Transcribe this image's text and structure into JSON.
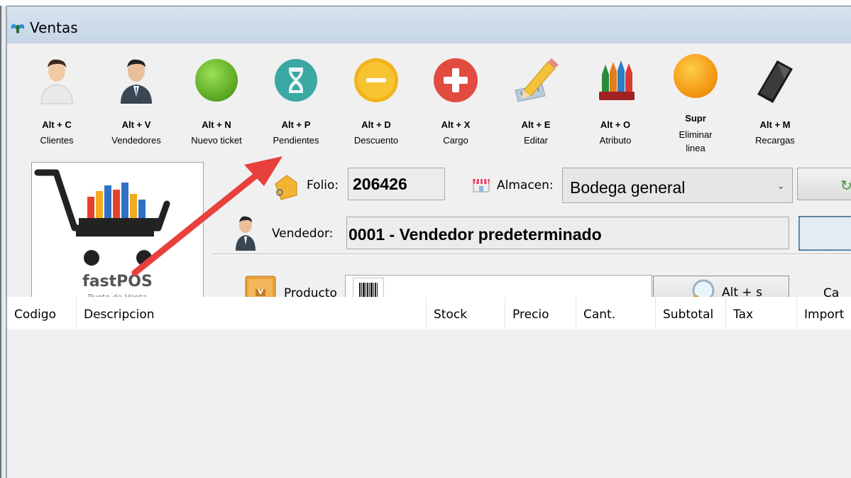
{
  "window": {
    "title": "Ventas"
  },
  "toolbar": {
    "buttons": [
      {
        "key": "Alt + C",
        "label": "Clientes",
        "icon": "client-person-icon"
      },
      {
        "key": "Alt + V",
        "label": "Vendedores",
        "icon": "seller-person-icon"
      },
      {
        "key": "Alt + N",
        "label": "Nuevo ticket",
        "icon": "green-circle-icon"
      },
      {
        "key": "Alt + P",
        "label": "Pendientes",
        "icon": "hourglass-icon"
      },
      {
        "key": "Alt + D",
        "label": "Descuento",
        "icon": "minus-circle-icon"
      },
      {
        "key": "Alt + X",
        "label": "Cargo",
        "icon": "plus-circle-icon"
      },
      {
        "key": "Alt + E",
        "label": "Editar",
        "icon": "pencil-ruler-icon"
      },
      {
        "key": "Alt + O",
        "label": "Atributo",
        "icon": "crayons-icon"
      },
      {
        "key": "Supr",
        "label": "Eliminar\nlinea",
        "icon": "orange-circle-icon"
      },
      {
        "key": "Alt + M",
        "label": "Recargas",
        "icon": "smartphone-icon"
      }
    ]
  },
  "logo": {
    "name": "fastPOS",
    "tagline": "Punto de Venta",
    "registered": "®"
  },
  "form": {
    "folio_label": "Folio:",
    "folio_value": "206426",
    "almacen_label": "Almacen:",
    "almacen_value": "Bodega general",
    "vendedor_label": "Vendedor:",
    "vendedor_value": "0001 - Vendedor predeterminado",
    "producto_label": "Producto",
    "producto_value": "",
    "search_button": "Alt + s",
    "cantidad_label_partial": "Ca"
  },
  "grid": {
    "columns": [
      "Codigo",
      "Descripcion",
      "Stock",
      "Precio",
      "Cant.",
      "Subtotal",
      "Tax",
      "Import"
    ],
    "rows": []
  },
  "colors": {
    "titlebar": "#c9d8e8",
    "client_bg": "#f0f0f0",
    "annotation_arrow": "#e8403c"
  }
}
